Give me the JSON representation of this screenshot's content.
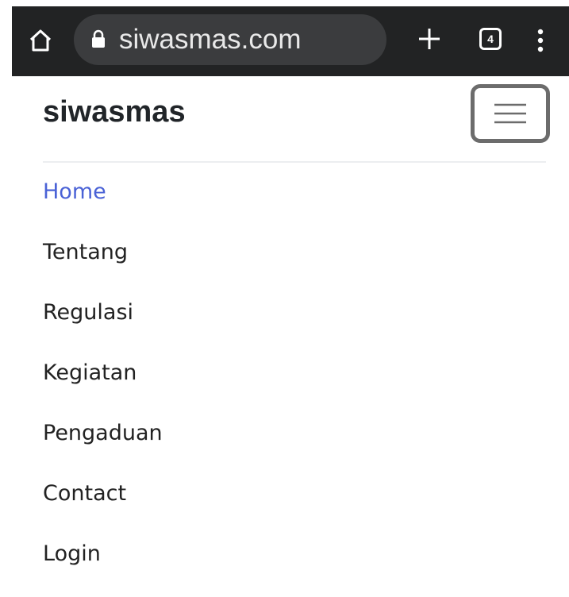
{
  "browser": {
    "url": "siwasmas.com",
    "tab_count": "4",
    "icons": {
      "home": "home-icon",
      "lock": "lock-icon",
      "new_tab": "plus-icon",
      "tabs": "tab-switcher-icon",
      "menu": "more-vert-icon"
    }
  },
  "site": {
    "brand": "siwasmas",
    "toggler_icon": "hamburger-icon"
  },
  "nav": {
    "items": [
      {
        "label": "Home",
        "active": true
      },
      {
        "label": "Tentang",
        "active": false
      },
      {
        "label": "Regulasi",
        "active": false
      },
      {
        "label": "Kegiatan",
        "active": false
      },
      {
        "label": "Pengaduan",
        "active": false
      },
      {
        "label": "Contact",
        "active": false
      },
      {
        "label": "Login",
        "active": false
      }
    ]
  },
  "colors": {
    "browser_bar": "#222324",
    "url_pill": "#3b3c3e",
    "active_link": "#4a62d6",
    "link": "#222222",
    "brand_text": "#212529"
  }
}
